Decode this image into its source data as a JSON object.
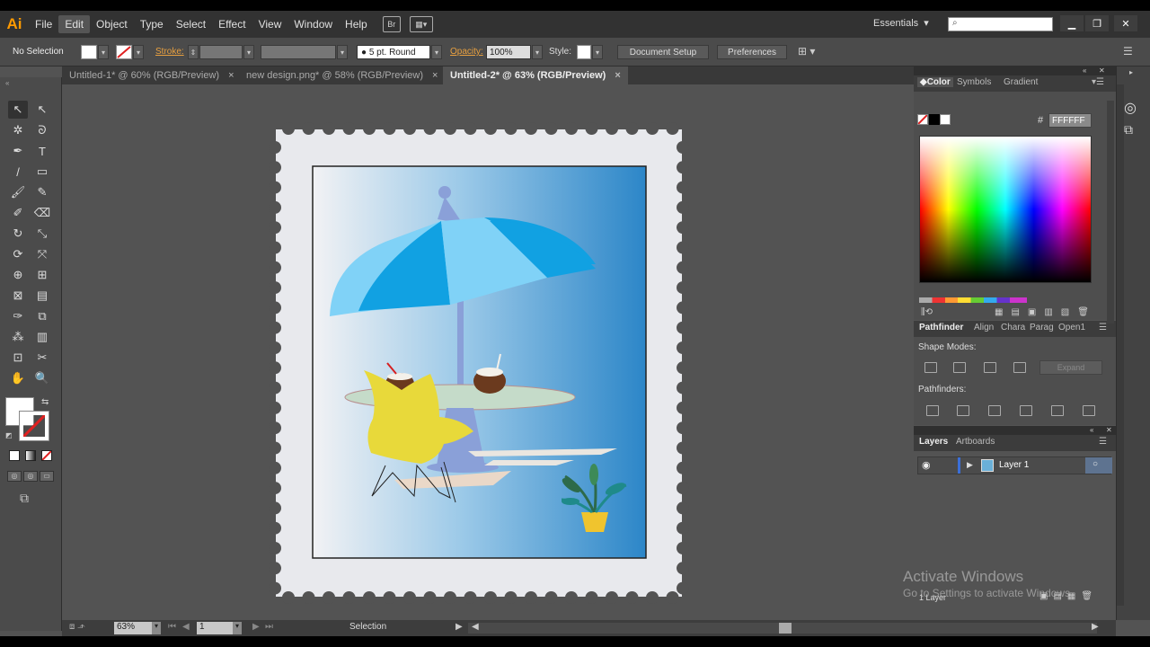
{
  "app": {
    "logo": "Ai"
  },
  "menu": [
    "File",
    "Edit",
    "Object",
    "Type",
    "Select",
    "Effect",
    "View",
    "Window",
    "Help"
  ],
  "menu_icons": {
    "bridge": "Br"
  },
  "workspace": {
    "label": "Essentials",
    "chevron": "▾"
  },
  "search": {
    "placeholder": ""
  },
  "window_buttons": [
    "minimize-icon",
    "restore-icon",
    "close-icon"
  ],
  "controlbar": {
    "selection": "No Selection",
    "stroke_label": "Stroke:",
    "brush": "5 pt. Round",
    "opacity_label": "Opacity:",
    "opacity_value": "100%",
    "style_label": "Style:",
    "doc_setup": "Document Setup",
    "preferences": "Preferences"
  },
  "tabs": [
    {
      "label": "Untitled-1* @ 60% (RGB/Preview)",
      "active": false
    },
    {
      "label": "new design.png* @ 58% (RGB/Preview)",
      "active": false
    },
    {
      "label": "Untitled-2* @ 63% (RGB/Preview)",
      "active": true
    }
  ],
  "tab_close": "×",
  "tools": [
    "selection-tool-icon",
    "direct-selection-tool-icon",
    "magic-wand-icon",
    "lasso-icon",
    "pen-tool-icon",
    "type-tool-icon",
    "line-tool-icon",
    "rectangle-tool-icon",
    "paintbrush-icon",
    "pencil-icon",
    "blob-brush-icon",
    "eraser-icon",
    "rotate-icon",
    "scale-icon",
    "width-tool-icon",
    "free-transform-icon",
    "shape-builder-icon",
    "perspective-grid-icon",
    "mesh-icon",
    "gradient-icon",
    "eyedropper-icon",
    "blend-icon",
    "symbol-sprayer-icon",
    "graph-icon",
    "artboard-icon",
    "slice-icon",
    "hand-icon",
    "zoom-icon"
  ],
  "tool_glyphs": [
    "↖",
    "↖",
    "✲",
    "ᘐ",
    "✒",
    "T",
    "/",
    "▭",
    "🖌",
    "✎",
    "✐",
    "⌫",
    "↻",
    "⤡",
    "⟳",
    "⤧",
    "⊕",
    "⊞",
    "⊠",
    "▤",
    "✑",
    "⧉",
    "⁂",
    "▥",
    "⊡",
    "✂",
    "✋",
    "🔍"
  ],
  "color_panel": {
    "tabs": [
      "Color",
      "Symbols",
      "Gradient"
    ],
    "hex_label": "#",
    "hex_value": "FFFFFF"
  },
  "pathfinder_panel": {
    "tabs": [
      "Pathfinder",
      "Align",
      "Chara",
      "Parag",
      "Open1"
    ],
    "shape_modes_label": "Shape Modes:",
    "expand": "Expand",
    "pathfinders_label": "Pathfinders:"
  },
  "layers_panel": {
    "tabs": [
      "Layers",
      "Artboards"
    ],
    "layer_name": "Layer 1",
    "layer_count": "1 Layer"
  },
  "statusbar": {
    "zoom": "63%",
    "page": "1",
    "mode": "Selection"
  },
  "watermark": {
    "title": "Activate Windows",
    "subtitle": "Go to Settings to activate Windows."
  },
  "colors": {
    "accent_orange": "#ff9a00",
    "umbrella_light": "#80d2f7",
    "umbrella_dark": "#11a1e2",
    "chair": "#e8d93a",
    "table": "#c5dbc9",
    "sky_right": "#2c86c8"
  }
}
